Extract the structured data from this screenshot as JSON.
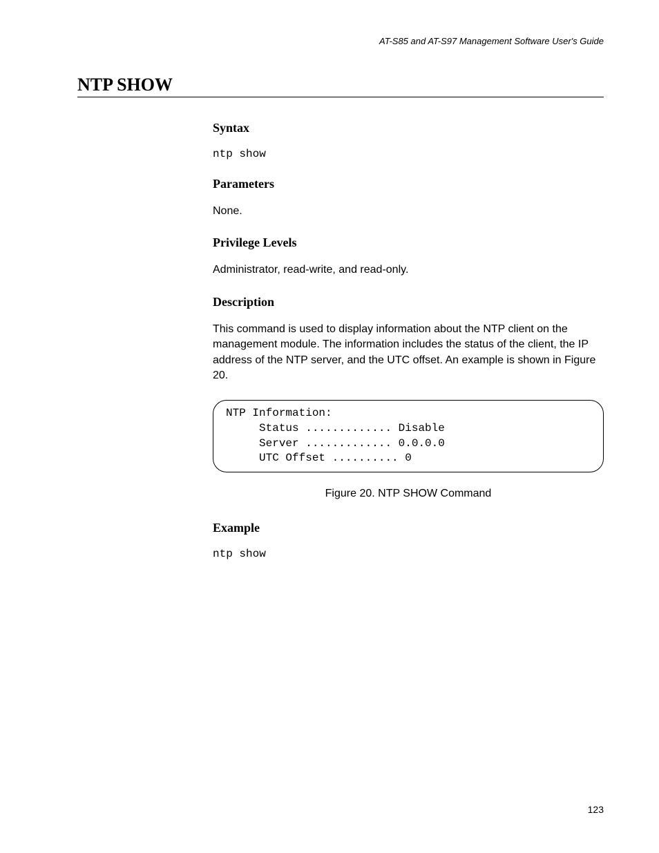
{
  "header": {
    "guide_title": "AT-S85 and AT-S97 Management Software User's Guide"
  },
  "page": {
    "title": "NTP SHOW",
    "number": "123"
  },
  "sections": {
    "syntax": {
      "heading": "Syntax",
      "code": "ntp show"
    },
    "parameters": {
      "heading": "Parameters",
      "text": "None."
    },
    "privilege": {
      "heading": "Privilege Levels",
      "text": "Administrator, read-write, and read-only."
    },
    "description": {
      "heading": "Description",
      "text": "This command is used to display information about the NTP client on the management module. The information includes the status of the client, the IP address of the NTP server, and the UTC offset. An example is shown in Figure 20."
    },
    "figure": {
      "content": "NTP Information:\n     Status ............. Disable\n     Server ............. 0.0.0.0\n     UTC Offset .......... 0",
      "caption": "Figure 20. NTP SHOW Command"
    },
    "example": {
      "heading": "Example",
      "code": "ntp show"
    }
  }
}
